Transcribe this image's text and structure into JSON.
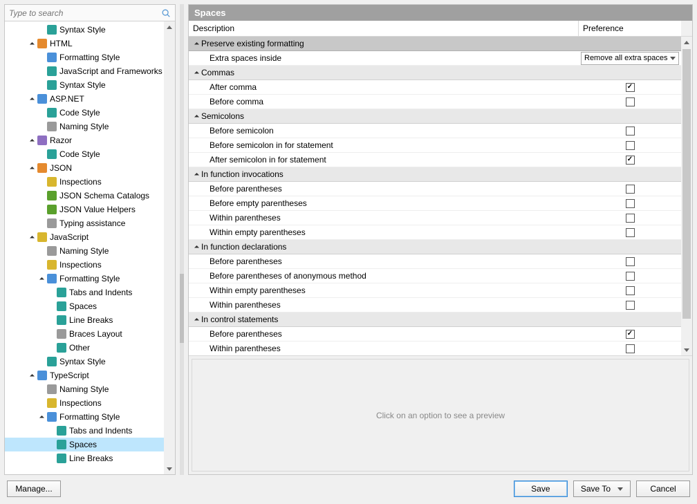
{
  "search": {
    "placeholder": "Type to search"
  },
  "tree": [
    {
      "depth": 3,
      "exp": "none",
      "icon": "ic-teal",
      "name": "syntax-style",
      "label": "Syntax Style"
    },
    {
      "depth": 2,
      "exp": "open",
      "icon": "ic-orange",
      "name": "html",
      "label": "HTML"
    },
    {
      "depth": 3,
      "exp": "none",
      "icon": "ic-blue",
      "name": "html-formatting",
      "label": "Formatting Style"
    },
    {
      "depth": 3,
      "exp": "none",
      "icon": "ic-teal",
      "name": "html-js-frameworks",
      "label": "JavaScript and Frameworks"
    },
    {
      "depth": 3,
      "exp": "none",
      "icon": "ic-teal",
      "name": "html-syntax-style",
      "label": "Syntax Style"
    },
    {
      "depth": 2,
      "exp": "open",
      "icon": "ic-blue",
      "name": "aspnet",
      "label": "ASP.NET"
    },
    {
      "depth": 3,
      "exp": "none",
      "icon": "ic-teal",
      "name": "aspnet-code-style",
      "label": "Code Style"
    },
    {
      "depth": 3,
      "exp": "none",
      "icon": "ic-gray",
      "name": "aspnet-naming-style",
      "label": "Naming Style"
    },
    {
      "depth": 2,
      "exp": "open",
      "icon": "ic-purple",
      "name": "razor",
      "label": "Razor"
    },
    {
      "depth": 3,
      "exp": "none",
      "icon": "ic-teal",
      "name": "razor-code-style",
      "label": "Code Style"
    },
    {
      "depth": 2,
      "exp": "open",
      "icon": "ic-orange",
      "name": "json",
      "label": "JSON"
    },
    {
      "depth": 3,
      "exp": "none",
      "icon": "ic-yellow",
      "name": "json-inspections",
      "label": "Inspections"
    },
    {
      "depth": 3,
      "exp": "none",
      "icon": "ic-green",
      "name": "json-schema-catalogs",
      "label": "JSON Schema Catalogs"
    },
    {
      "depth": 3,
      "exp": "none",
      "icon": "ic-green",
      "name": "json-value-helpers",
      "label": "JSON Value Helpers"
    },
    {
      "depth": 3,
      "exp": "none",
      "icon": "ic-gray",
      "name": "json-typing-assist",
      "label": "Typing assistance"
    },
    {
      "depth": 2,
      "exp": "open",
      "icon": "ic-yellow",
      "name": "javascript",
      "label": "JavaScript"
    },
    {
      "depth": 3,
      "exp": "none",
      "icon": "ic-gray",
      "name": "js-naming-style",
      "label": "Naming Style"
    },
    {
      "depth": 3,
      "exp": "none",
      "icon": "ic-yellow",
      "name": "js-inspections",
      "label": "Inspections"
    },
    {
      "depth": 3,
      "exp": "open",
      "icon": "ic-blue",
      "name": "js-formatting-style",
      "label": "Formatting Style"
    },
    {
      "depth": 4,
      "exp": "none",
      "icon": "ic-teal",
      "name": "js-tabs-indents",
      "label": "Tabs and Indents"
    },
    {
      "depth": 4,
      "exp": "none",
      "icon": "ic-teal",
      "name": "js-spaces",
      "label": "Spaces"
    },
    {
      "depth": 4,
      "exp": "none",
      "icon": "ic-teal",
      "name": "js-line-breaks",
      "label": "Line Breaks"
    },
    {
      "depth": 4,
      "exp": "none",
      "icon": "ic-gray",
      "name": "js-braces-layout",
      "label": "Braces Layout"
    },
    {
      "depth": 4,
      "exp": "none",
      "icon": "ic-teal",
      "name": "js-other",
      "label": "Other"
    },
    {
      "depth": 3,
      "exp": "none",
      "icon": "ic-teal",
      "name": "js-syntax-style",
      "label": "Syntax Style"
    },
    {
      "depth": 2,
      "exp": "open",
      "icon": "ic-blue",
      "name": "typescript",
      "label": "TypeScript"
    },
    {
      "depth": 3,
      "exp": "none",
      "icon": "ic-gray",
      "name": "ts-naming-style",
      "label": "Naming Style"
    },
    {
      "depth": 3,
      "exp": "none",
      "icon": "ic-yellow",
      "name": "ts-inspections",
      "label": "Inspections"
    },
    {
      "depth": 3,
      "exp": "open",
      "icon": "ic-blue",
      "name": "ts-formatting-style",
      "label": "Formatting Style"
    },
    {
      "depth": 4,
      "exp": "none",
      "icon": "ic-teal",
      "name": "ts-tabs-indents",
      "label": "Tabs and Indents"
    },
    {
      "depth": 4,
      "exp": "none",
      "icon": "ic-teal",
      "name": "ts-spaces",
      "label": "Spaces",
      "selected": true
    },
    {
      "depth": 4,
      "exp": "none",
      "icon": "ic-teal",
      "name": "ts-line-breaks",
      "label": "Line Breaks"
    }
  ],
  "panel": {
    "title": "Spaces",
    "col_desc": "Description",
    "col_pref": "Preference",
    "preview_hint": "Click on an option to see a preview"
  },
  "rows": [
    {
      "type": "topcat",
      "label": "Preserve existing formatting"
    },
    {
      "type": "opt",
      "label": "Extra spaces inside",
      "pref": {
        "kind": "dropdown",
        "value": "Remove all extra spaces"
      }
    },
    {
      "type": "cat",
      "label": "Commas"
    },
    {
      "type": "opt",
      "label": "After comma",
      "pref": {
        "kind": "check",
        "checked": true
      }
    },
    {
      "type": "opt",
      "label": "Before comma",
      "pref": {
        "kind": "check",
        "checked": false
      }
    },
    {
      "type": "cat",
      "label": "Semicolons"
    },
    {
      "type": "opt",
      "label": "Before semicolon",
      "pref": {
        "kind": "check",
        "checked": false
      }
    },
    {
      "type": "opt",
      "label": "Before semicolon in for statement",
      "pref": {
        "kind": "check",
        "checked": false
      }
    },
    {
      "type": "opt",
      "label": "After semicolon in for statement",
      "pref": {
        "kind": "check",
        "checked": true
      }
    },
    {
      "type": "cat",
      "label": "In function invocations"
    },
    {
      "type": "opt",
      "label": "Before parentheses",
      "pref": {
        "kind": "check",
        "checked": false
      }
    },
    {
      "type": "opt",
      "label": "Before empty parentheses",
      "pref": {
        "kind": "check",
        "checked": false
      }
    },
    {
      "type": "opt",
      "label": "Within parentheses",
      "pref": {
        "kind": "check",
        "checked": false
      }
    },
    {
      "type": "opt",
      "label": "Within empty parentheses",
      "pref": {
        "kind": "check",
        "checked": false
      }
    },
    {
      "type": "cat",
      "label": "In function declarations"
    },
    {
      "type": "opt",
      "label": "Before parentheses",
      "pref": {
        "kind": "check",
        "checked": false
      }
    },
    {
      "type": "opt",
      "label": "Before parentheses of anonymous method",
      "pref": {
        "kind": "check",
        "checked": false
      }
    },
    {
      "type": "opt",
      "label": "Within empty parentheses",
      "pref": {
        "kind": "check",
        "checked": false
      }
    },
    {
      "type": "opt",
      "label": "Within parentheses",
      "pref": {
        "kind": "check",
        "checked": false
      }
    },
    {
      "type": "cat",
      "label": "In control statements"
    },
    {
      "type": "opt",
      "label": "Before parentheses",
      "pref": {
        "kind": "check",
        "checked": true
      }
    },
    {
      "type": "opt",
      "label": "Within parentheses",
      "pref": {
        "kind": "check",
        "checked": false
      }
    }
  ],
  "footer": {
    "manage": "Manage...",
    "save": "Save",
    "save_to": "Save To",
    "cancel": "Cancel"
  }
}
